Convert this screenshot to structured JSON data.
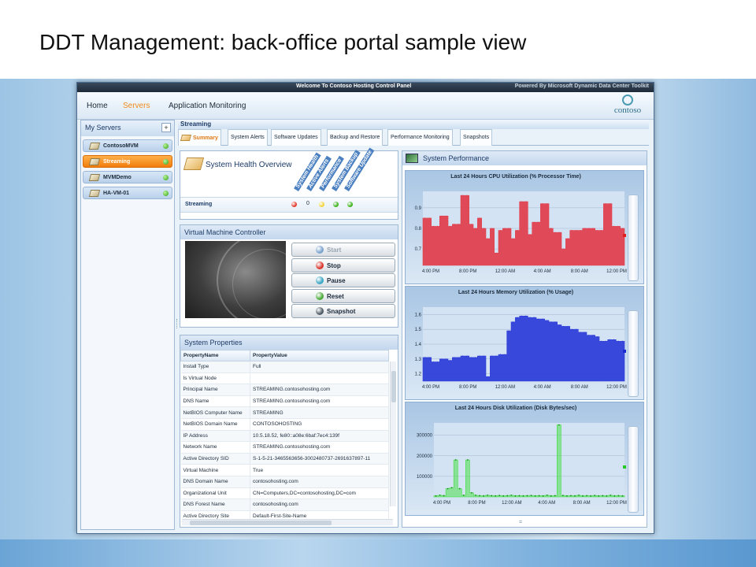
{
  "slide": {
    "title": "DDT Management: back-office portal sample view"
  },
  "window": {
    "title": "Welcome To Contoso Hosting Control Panel",
    "powered_by": "Powered By Microsoft Dynamic Data Center Toolkit"
  },
  "menu": {
    "items": [
      "Home",
      "Servers",
      "Application Monitoring"
    ],
    "active": "Servers"
  },
  "logo": {
    "text": "contoso"
  },
  "sidebar": {
    "title": "My Servers",
    "add_label": "+",
    "servers": [
      {
        "name": "ContosoMVM",
        "status": "green"
      },
      {
        "name": "Streaming",
        "status": "green",
        "selected": true
      },
      {
        "name": "MVMDemo",
        "status": "green"
      },
      {
        "name": "HA-VM-01",
        "status": "green"
      }
    ]
  },
  "main": {
    "header": "Streaming",
    "tabs": [
      "Summary",
      "System Alerts",
      "Software Updates",
      "Backup and Restore",
      "Performance Monitoring",
      "Snapshots"
    ],
    "active_tab": "Summary"
  },
  "health": {
    "title": "System Health Overview",
    "columns": [
      "System Health",
      "Active Alerts",
      "Performance",
      "System Backup",
      "Software Update"
    ],
    "server": "Streaming",
    "count": "0",
    "indicators": [
      "#e23b2e",
      "#f2d43a",
      "#3fb21f",
      "#3fb21f"
    ]
  },
  "vm_controller": {
    "title": "Virtual Machine Controller",
    "buttons": [
      {
        "label": "Start",
        "enabled": false,
        "color": "#7aa2cf"
      },
      {
        "label": "Stop",
        "enabled": true,
        "color": "#d8342a"
      },
      {
        "label": "Pause",
        "enabled": true,
        "color": "#3aa7c4"
      },
      {
        "label": "Reset",
        "enabled": true,
        "color": "#4bab3a"
      },
      {
        "label": "Snapshot",
        "enabled": true,
        "color": "#4e5a66"
      }
    ]
  },
  "properties": {
    "title": "System Properties",
    "headers": [
      "PropertyName",
      "PropertyValue"
    ],
    "rows": [
      [
        "Install Type",
        "Full"
      ],
      [
        "Is Virtual Node",
        ""
      ],
      [
        "Principal Name",
        "STREAMING.contosohosting.com"
      ],
      [
        "DNS Name",
        "STREAMING.contosohosting.com"
      ],
      [
        "NetBIOS Computer Name",
        "STREAMING"
      ],
      [
        "NetBIOS Domain Name",
        "CONTOSOHOSTING"
      ],
      [
        "IP Address",
        "10.5.18.52, fe80::a08e:6baf:7ec4:139f"
      ],
      [
        "Network Name",
        "STREAMING.contosohosting.com"
      ],
      [
        "Active Directory SID",
        "S-1-5-21-3465563656-3002480737-2691637897-11"
      ],
      [
        "Virtual Machine",
        "True"
      ],
      [
        "DNS Domain Name",
        "contosohosting.com"
      ],
      [
        "Organizational Unit",
        "CN=Computers,DC=contosohosting,DC=com"
      ],
      [
        "DNS Forest Name",
        "contosohosting.com"
      ],
      [
        "Active Directory Site",
        "Default-First-Site-Name"
      ]
    ]
  },
  "performance": {
    "title": "System Performance"
  },
  "chart_data": [
    {
      "type": "area",
      "title": "Last 24 Hours CPU Utilization (% Processor Time)",
      "x_ticks": [
        "4:00 PM",
        "8:00 PM",
        "12:00 AM",
        "4:00 AM",
        "8:00 AM",
        "12:00 PM"
      ],
      "y_ticks": [
        "0.7",
        "0.8",
        "0.9"
      ],
      "ylim": [
        0.62,
        0.98
      ],
      "color": "#e0414f",
      "legend_color": "#e02020",
      "values": [
        0.85,
        0.85,
        0.81,
        0.81,
        0.86,
        0.86,
        0.81,
        0.82,
        0.82,
        0.96,
        0.96,
        0.82,
        0.8,
        0.85,
        0.8,
        0.75,
        0.8,
        0.68,
        0.79,
        0.8,
        0.8,
        0.75,
        0.79,
        0.93,
        0.93,
        0.77,
        0.83,
        0.83,
        0.92,
        0.92,
        0.8,
        0.78,
        0.78,
        0.7,
        0.75,
        0.79,
        0.79,
        0.79,
        0.8,
        0.8,
        0.8,
        0.79,
        0.79,
        0.92,
        0.92,
        0.81,
        0.81,
        0.8
      ]
    },
    {
      "type": "area",
      "title": "Last 24 Hours Memory Utilization (% Usage)",
      "x_ticks": [
        "4:00 PM",
        "8:00 PM",
        "12:00 AM",
        "4:00 AM",
        "8:00 AM",
        "12:00 PM"
      ],
      "y_ticks": [
        "1.2",
        "1.3",
        "1.4",
        "1.5",
        "1.6"
      ],
      "ylim": [
        1.15,
        1.65
      ],
      "color": "#2f3fd9",
      "legend_color": "#1a2cd0",
      "values": [
        1.31,
        1.31,
        1.28,
        1.28,
        1.3,
        1.3,
        1.29,
        1.31,
        1.31,
        1.32,
        1.32,
        1.31,
        1.31,
        1.32,
        1.32,
        1.18,
        1.32,
        1.32,
        1.33,
        1.33,
        1.49,
        1.55,
        1.58,
        1.59,
        1.59,
        1.58,
        1.58,
        1.57,
        1.57,
        1.56,
        1.55,
        1.55,
        1.53,
        1.52,
        1.52,
        1.5,
        1.5,
        1.48,
        1.48,
        1.46,
        1.46,
        1.45,
        1.42,
        1.42,
        1.43,
        1.43,
        1.42,
        1.42
      ]
    },
    {
      "type": "area",
      "title": "Last 24 Hours Disk Utilization (Disk Bytes/sec)",
      "x_ticks": [
        "4:00 PM",
        "8:00 PM",
        "12:00 AM",
        "4:00 AM",
        "8:00 AM",
        "12:00 PM"
      ],
      "y_ticks": [
        "100000",
        "200000",
        "300000"
      ],
      "ylim": [
        0,
        360000
      ],
      "color": "#3be03b",
      "legend_color": "#25c825",
      "values": [
        5000,
        8000,
        6000,
        40000,
        45000,
        180000,
        40000,
        8000,
        180000,
        20000,
        8000,
        6000,
        5000,
        8000,
        6000,
        5000,
        7000,
        5000,
        6000,
        8000,
        5000,
        6000,
        5000,
        6000,
        7000,
        5000,
        6000,
        5000,
        8000,
        5000,
        6000,
        350000,
        7000,
        5000,
        6000,
        5000,
        8000,
        5000,
        6000,
        5000,
        7000,
        5000,
        6000,
        5000,
        8000,
        5000,
        6000,
        5000
      ]
    }
  ]
}
